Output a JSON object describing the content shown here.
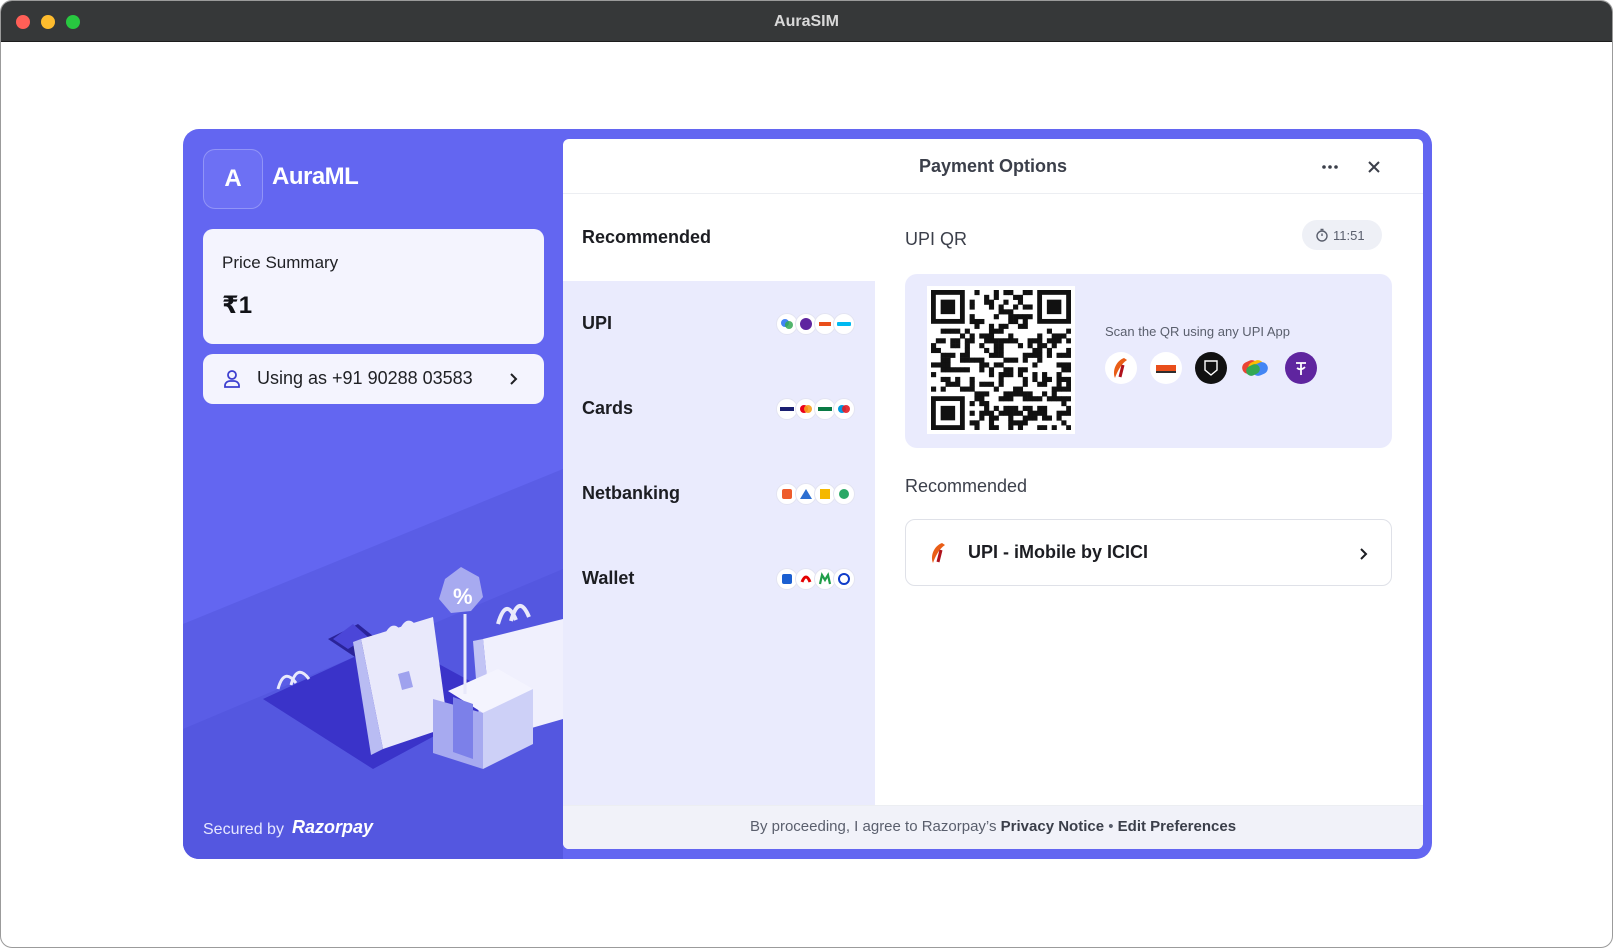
{
  "window": {
    "title": "AuraSIM"
  },
  "merchant": {
    "initial": "A",
    "name": "AuraML"
  },
  "summary": {
    "label": "Price Summary",
    "amount": "₹1"
  },
  "contact": {
    "text": "Using as +91 90288 03583"
  },
  "security": {
    "secured_by": "Secured by",
    "brand": "Razorpay"
  },
  "header": {
    "title": "Payment Options"
  },
  "methods": {
    "title": "Recommended",
    "items": [
      {
        "label": "UPI",
        "icons": [
          "google-pay",
          "phonepe",
          "bhim",
          "paytm"
        ]
      },
      {
        "label": "Cards",
        "icons": [
          "visa",
          "mastercard",
          "rupay",
          "maestro"
        ]
      },
      {
        "label": "Netbanking",
        "icons": [
          "bank-orange",
          "bank-blue",
          "bank-yellow",
          "bank-green"
        ]
      },
      {
        "label": "Wallet",
        "icons": [
          "mobikwik",
          "airtel",
          "m-wallet",
          "jiomoney"
        ]
      }
    ]
  },
  "qr": {
    "title": "UPI QR",
    "timer": "11:51",
    "scan_text": "Scan the QR using any UPI App",
    "apps": [
      "imobile-icici",
      "bhim",
      "cred",
      "google-pay",
      "phonepe"
    ]
  },
  "recommended": {
    "title": "Recommended",
    "item_label": "UPI - iMobile by ICICI"
  },
  "footer": {
    "prefix": "By proceeding, I agree to Razorpay’s",
    "privacy": "Privacy Notice",
    "separator": "•",
    "preferences": "Edit Preferences"
  },
  "colors": {
    "brand": "#6366f1",
    "panel": "#eaebfd",
    "titlebar": "#363839"
  }
}
